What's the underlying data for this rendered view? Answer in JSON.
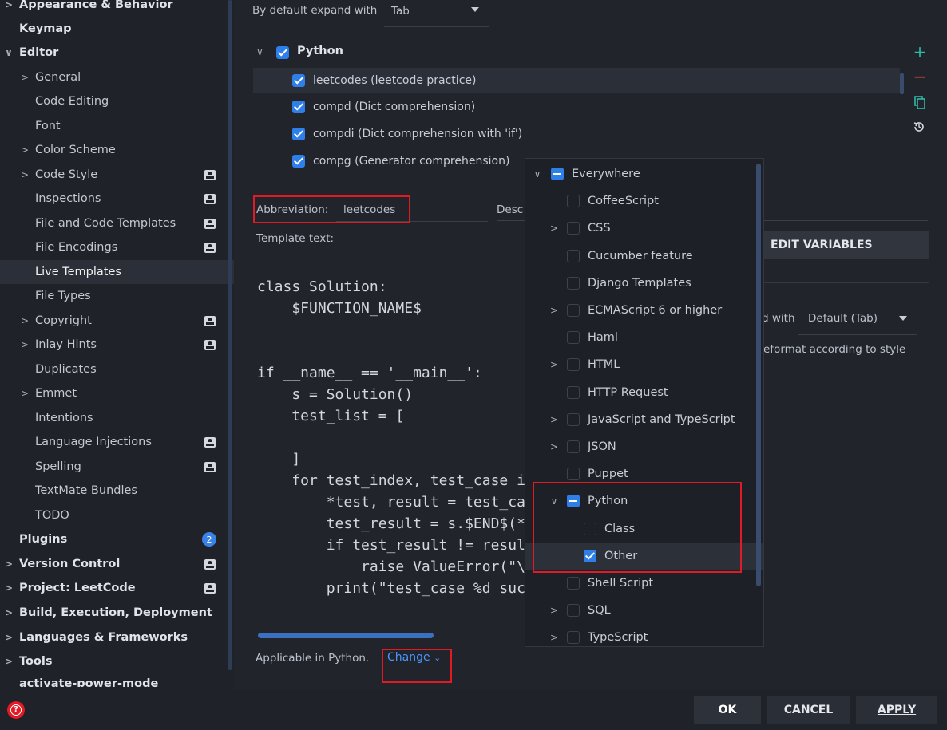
{
  "sidebar": {
    "items": [
      {
        "label": "Appearance & Behavior",
        "arrow": ">"
      },
      {
        "label": "Keymap"
      },
      {
        "label": "Editor",
        "arrow": "∨"
      },
      {
        "label": "General",
        "arrow": ">"
      },
      {
        "label": "Code Editing"
      },
      {
        "label": "Font"
      },
      {
        "label": "Color Scheme",
        "arrow": ">"
      },
      {
        "label": "Code Style",
        "arrow": ">"
      },
      {
        "label": "Inspections"
      },
      {
        "label": "File and Code Templates"
      },
      {
        "label": "File Encodings"
      },
      {
        "label": "Live Templates"
      },
      {
        "label": "File Types"
      },
      {
        "label": "Copyright",
        "arrow": ">"
      },
      {
        "label": "Inlay Hints",
        "arrow": ">"
      },
      {
        "label": "Duplicates"
      },
      {
        "label": "Emmet",
        "arrow": ">"
      },
      {
        "label": "Intentions"
      },
      {
        "label": "Language Injections"
      },
      {
        "label": "Spelling"
      },
      {
        "label": "TextMate Bundles"
      },
      {
        "label": "TODO"
      },
      {
        "label": "Plugins",
        "count": "2"
      },
      {
        "label": "Version Control",
        "arrow": ">"
      },
      {
        "label": "Project: LeetCode",
        "arrow": ">"
      },
      {
        "label": "Build, Execution, Deployment",
        "arrow": ">"
      },
      {
        "label": "Languages & Frameworks",
        "arrow": ">"
      },
      {
        "label": "Tools",
        "arrow": ">"
      },
      {
        "label": "activate-power-mode"
      }
    ]
  },
  "main": {
    "expand_label": "By default expand with",
    "expand_value": "Tab",
    "group_arrow": "∨",
    "group_name": "Python",
    "templates": [
      {
        "label": "leetcodes (leetcode practice)"
      },
      {
        "label": "compd (Dict comprehension)"
      },
      {
        "label": "compdi (Dict comprehension with 'if')"
      },
      {
        "label": "compg (Generator comprehension)"
      }
    ],
    "abbreviation_label": "Abbreviation:",
    "abbreviation_value": "leetcodes",
    "description_label": "Desc",
    "template_text_label": "Template text:",
    "edit_variables_label": "EDIT VARIABLES",
    "expand_with_label": "d with",
    "expand_with_value": "Default (Tab)",
    "reformat_label": "eformat according to style",
    "code_lines": [
      "class Solution:",
      "    $FUNCTION_NAME$",
      "",
      "",
      "if __name__ == '__main__':",
      "    s = Solution()",
      "    test_list = [",
      "",
      "    ]",
      "    for test_index, test_case i",
      "        *test, result = test_ca",
      "        test_result = s.$END$(*",
      "        if test_result != resul",
      "            raise ValueError(\"\\",
      "        print(\"test_case %d suc"
    ],
    "applicable_label": "Applicable in Python.",
    "change_label": "Change"
  },
  "popup": {
    "items": [
      {
        "label": "Everywhere",
        "arrow": "∨",
        "state": "mixed"
      },
      {
        "label": "CoffeeScript",
        "state": "off"
      },
      {
        "label": "CSS",
        "arrow": ">",
        "state": "off"
      },
      {
        "label": "Cucumber feature",
        "state": "off"
      },
      {
        "label": "Django Templates",
        "state": "off"
      },
      {
        "label": "ECMAScript 6 or higher",
        "arrow": ">",
        "state": "off"
      },
      {
        "label": "Haml",
        "state": "off"
      },
      {
        "label": "HTML",
        "arrow": ">",
        "state": "off"
      },
      {
        "label": "HTTP Request",
        "state": "off"
      },
      {
        "label": "JavaScript and TypeScript",
        "arrow": ">",
        "state": "off"
      },
      {
        "label": "JSON",
        "arrow": ">",
        "state": "off"
      },
      {
        "label": "Puppet",
        "state": "off"
      },
      {
        "label": "Python",
        "arrow": "∨",
        "state": "mixed"
      },
      {
        "label": "Class",
        "state": "off"
      },
      {
        "label": "Other",
        "state": "on"
      },
      {
        "label": "Shell Script",
        "state": "off"
      },
      {
        "label": "SQL",
        "arrow": ">",
        "state": "off"
      },
      {
        "label": "TypeScript",
        "arrow": ">",
        "state": "off"
      }
    ]
  },
  "buttons": {
    "ok": "OK",
    "cancel": "CANCEL",
    "apply": "APPLY"
  },
  "colors": {
    "accent": "#2f7fe8",
    "highlight_box": "#e11a24",
    "add_icon": "#2fb8a6",
    "remove_icon": "#e0463f"
  },
  "icons": [
    "add-icon",
    "remove-icon",
    "copy-icon",
    "restore-icon",
    "help-icon",
    "dropdown-arrow-icon"
  ]
}
